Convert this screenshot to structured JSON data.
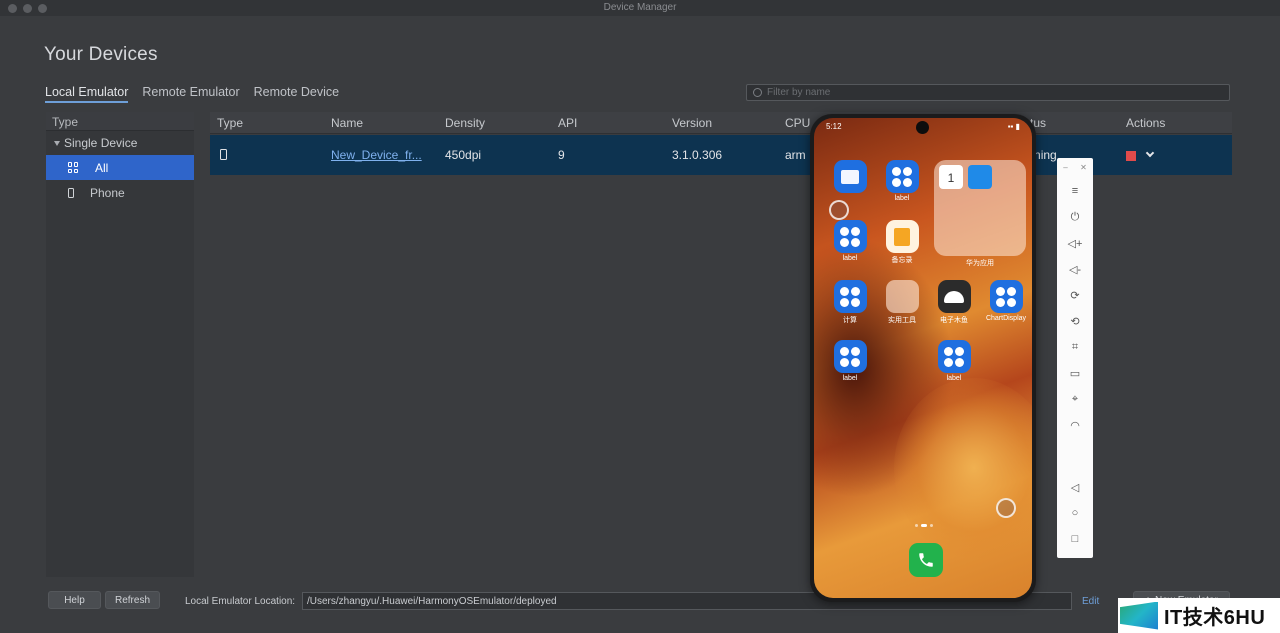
{
  "window": {
    "title": "Device Manager"
  },
  "page_title": "Your Devices",
  "tabs": [
    {
      "label": "Local Emulator",
      "active": true
    },
    {
      "label": "Remote Emulator",
      "active": false
    },
    {
      "label": "Remote Device",
      "active": false
    }
  ],
  "search": {
    "placeholder": "Filter by name"
  },
  "sidebar": {
    "header": "Type",
    "group": "Single Device",
    "items": [
      {
        "label": "All",
        "selected": true,
        "icon": "grid-icon"
      },
      {
        "label": "Phone",
        "selected": false,
        "icon": "phone-icon"
      }
    ]
  },
  "table": {
    "columns": [
      "Type",
      "Name",
      "Density",
      "API",
      "Version",
      "CPU",
      "Status",
      "Actions"
    ],
    "rows": [
      {
        "type_icon": "phone-icon",
        "name": "New_Device_fr...",
        "density": "450dpi",
        "api": "9",
        "version": "3.1.0.306",
        "cpu": "arm",
        "status": "Running"
      }
    ]
  },
  "footer": {
    "help_label": "Help",
    "refresh_label": "Refresh",
    "location_label": "Local Emulator Location:",
    "location_value": "/Users/zhangyu/.Huawei/HarmonyOSEmulator/deployed",
    "edit_label": "Edit",
    "new_emulator_label": "New Emulator"
  },
  "phone": {
    "time": "5:12",
    "apps": [
      {
        "label": ""
      },
      {
        "label": "label"
      },
      {
        "label": "label"
      },
      {
        "label": "备忘录"
      },
      {
        "label": "计算"
      },
      {
        "label": "实用工具"
      },
      {
        "label": "电子木鱼"
      },
      {
        "label": "ChartDisplay"
      },
      {
        "label": "label"
      },
      {
        "label": "label"
      }
    ],
    "widget_label": "华为应用",
    "widget_date": "1"
  },
  "toolbar": {
    "buttons": [
      "menu-icon",
      "power-icon",
      "volume-up-icon",
      "volume-down-icon",
      "rotate-icon",
      "rotate-back-icon",
      "crop-icon",
      "battery-icon",
      "location-icon",
      "wifi-icon",
      "back-icon",
      "home-icon",
      "recent-icon"
    ]
  },
  "watermark": {
    "text": "IT技术6HU"
  },
  "colors": {
    "accent": "#2f65ca",
    "row_selected": "#0d3350",
    "link": "#7fb1ee",
    "stop": "#e04b4b"
  }
}
